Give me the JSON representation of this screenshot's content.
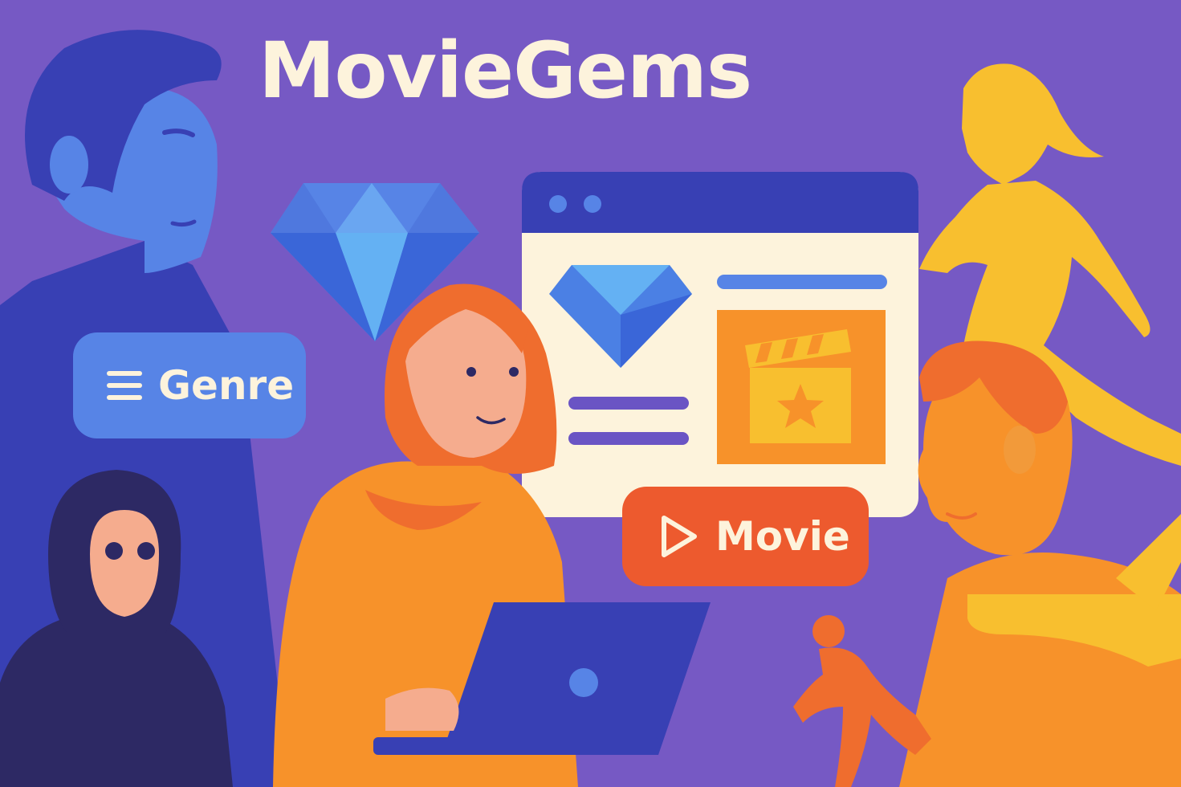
{
  "app": {
    "title": "MovieGems"
  },
  "tags": {
    "genre": {
      "label": "Genre",
      "icon": "menu-icon"
    },
    "movie": {
      "label": "Movie",
      "icon": "play-icon"
    }
  },
  "colors": {
    "background": "#7659c4",
    "title_text": "#fdf3dc",
    "genre_pill": "#5784e6",
    "movie_pill": "#ed5a2e",
    "window_header": "#3840b4",
    "window_body": "#fdf3dc",
    "accent_orange": "#f7922a",
    "accent_yellow": "#f8bf2f"
  }
}
